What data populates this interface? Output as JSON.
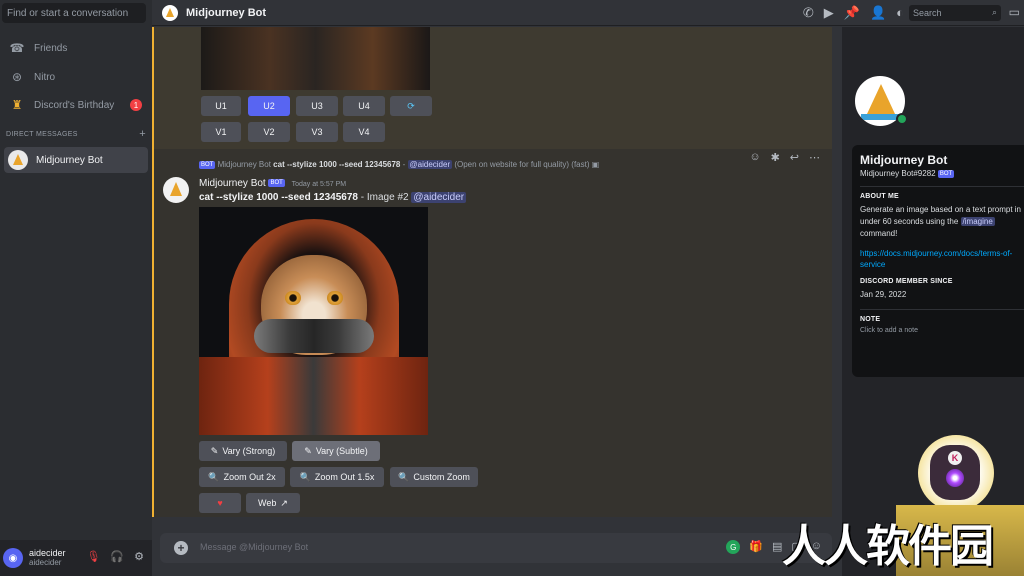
{
  "sidebar": {
    "search_placeholder": "Find or start a conversation",
    "items": [
      {
        "label": "Friends",
        "icon": "friends-icon"
      },
      {
        "label": "Nitro",
        "icon": "nitro-icon"
      },
      {
        "label": "Discord's Birthday",
        "icon": "birthday-icon",
        "badge": "1"
      }
    ],
    "dm_header": "DIRECT MESSAGES",
    "dm_add": "+",
    "dms": [
      {
        "label": "Midjourney Bot",
        "active": true
      }
    ],
    "user": {
      "name": "aidecider",
      "handle": "aidecider"
    }
  },
  "topbar": {
    "title": "Midjourney Bot",
    "search_placeholder": "Search"
  },
  "prev_message": {
    "upscale_buttons": [
      "U1",
      "U2",
      "U3",
      "U4"
    ],
    "variation_buttons": [
      "V1",
      "V2",
      "V3",
      "V4"
    ],
    "selected": "U2",
    "reroll_icon": "reroll-icon"
  },
  "message": {
    "reply": {
      "bot_tag": "BOT",
      "author": "Midjourney Bot",
      "prompt": "cat --stylize 1000 --seed 12345678",
      "dash": "-",
      "mention": "@aidecider",
      "suffix": "(Open on website for full quality) (fast)"
    },
    "author": "Midjourney Bot",
    "bot_tag": "BOT",
    "timestamp": "Today at 5:57 PM",
    "prompt": "cat --stylize 1000 --seed 12345678",
    "image_label": "- Image #2",
    "mention": "@aidecider",
    "buttons_row1": [
      "Vary (Strong)",
      "Vary (Subtle)"
    ],
    "buttons_row2": [
      "Zoom Out 2x",
      "Zoom Out 1.5x",
      "Custom Zoom"
    ],
    "web_label": "Web"
  },
  "chat": {
    "placeholder": "Message @Midjourney Bot"
  },
  "profile": {
    "name": "Midjourney Bot",
    "tag": "Midjourney Bot#9282",
    "bot_tag": "BOT",
    "about_header": "ABOUT ME",
    "about_text_1": "Generate an image based on a text prompt in",
    "about_text_2": "under 60 seconds using the",
    "about_cmd": "/imagine",
    "about_text_3": "command!",
    "link": "https://docs.midjourney.com/docs/terms-of-service",
    "member_header": "DISCORD MEMBER SINCE",
    "member_since": "Jan 29, 2022",
    "note_header": "NOTE",
    "note_placeholder": "Click to add a note"
  },
  "overlay": {
    "watermark": "人人软件园",
    "robot_letter": "K"
  },
  "colors": {
    "accent": "#5865f2",
    "online": "#23a55a",
    "highlight": "#f0b132"
  }
}
